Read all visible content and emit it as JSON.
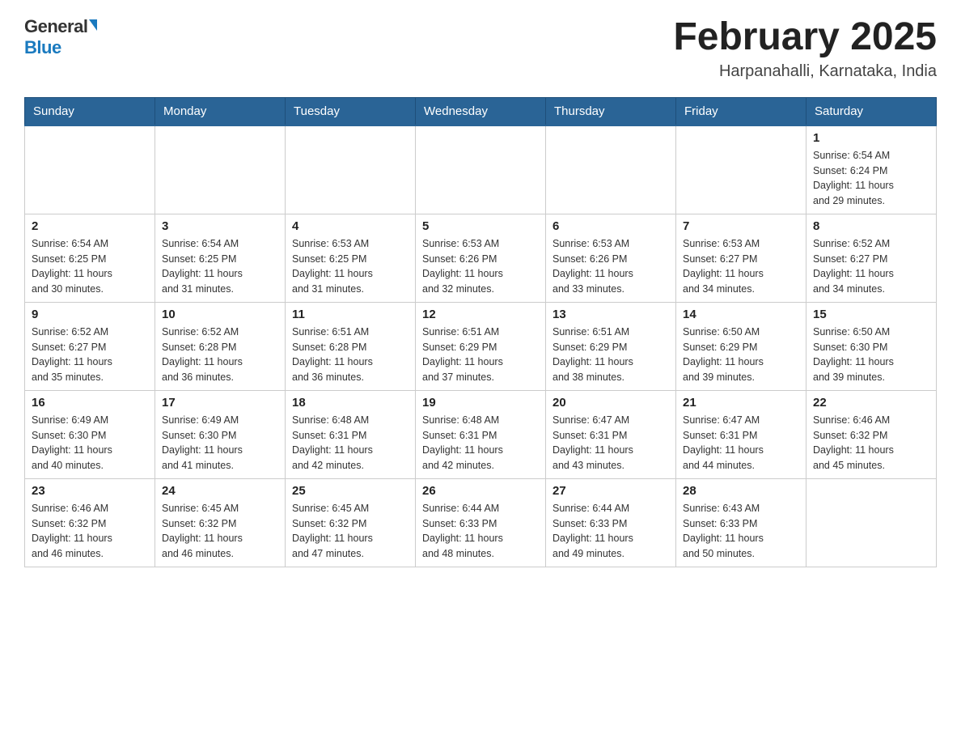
{
  "header": {
    "logo_general": "General",
    "logo_blue": "Blue",
    "month_title": "February 2025",
    "location": "Harpanahalli, Karnataka, India"
  },
  "weekdays": [
    "Sunday",
    "Monday",
    "Tuesday",
    "Wednesday",
    "Thursday",
    "Friday",
    "Saturday"
  ],
  "weeks": [
    [
      {
        "day": "",
        "info": ""
      },
      {
        "day": "",
        "info": ""
      },
      {
        "day": "",
        "info": ""
      },
      {
        "day": "",
        "info": ""
      },
      {
        "day": "",
        "info": ""
      },
      {
        "day": "",
        "info": ""
      },
      {
        "day": "1",
        "info": "Sunrise: 6:54 AM\nSunset: 6:24 PM\nDaylight: 11 hours\nand 29 minutes."
      }
    ],
    [
      {
        "day": "2",
        "info": "Sunrise: 6:54 AM\nSunset: 6:25 PM\nDaylight: 11 hours\nand 30 minutes."
      },
      {
        "day": "3",
        "info": "Sunrise: 6:54 AM\nSunset: 6:25 PM\nDaylight: 11 hours\nand 31 minutes."
      },
      {
        "day": "4",
        "info": "Sunrise: 6:53 AM\nSunset: 6:25 PM\nDaylight: 11 hours\nand 31 minutes."
      },
      {
        "day": "5",
        "info": "Sunrise: 6:53 AM\nSunset: 6:26 PM\nDaylight: 11 hours\nand 32 minutes."
      },
      {
        "day": "6",
        "info": "Sunrise: 6:53 AM\nSunset: 6:26 PM\nDaylight: 11 hours\nand 33 minutes."
      },
      {
        "day": "7",
        "info": "Sunrise: 6:53 AM\nSunset: 6:27 PM\nDaylight: 11 hours\nand 34 minutes."
      },
      {
        "day": "8",
        "info": "Sunrise: 6:52 AM\nSunset: 6:27 PM\nDaylight: 11 hours\nand 34 minutes."
      }
    ],
    [
      {
        "day": "9",
        "info": "Sunrise: 6:52 AM\nSunset: 6:27 PM\nDaylight: 11 hours\nand 35 minutes."
      },
      {
        "day": "10",
        "info": "Sunrise: 6:52 AM\nSunset: 6:28 PM\nDaylight: 11 hours\nand 36 minutes."
      },
      {
        "day": "11",
        "info": "Sunrise: 6:51 AM\nSunset: 6:28 PM\nDaylight: 11 hours\nand 36 minutes."
      },
      {
        "day": "12",
        "info": "Sunrise: 6:51 AM\nSunset: 6:29 PM\nDaylight: 11 hours\nand 37 minutes."
      },
      {
        "day": "13",
        "info": "Sunrise: 6:51 AM\nSunset: 6:29 PM\nDaylight: 11 hours\nand 38 minutes."
      },
      {
        "day": "14",
        "info": "Sunrise: 6:50 AM\nSunset: 6:29 PM\nDaylight: 11 hours\nand 39 minutes."
      },
      {
        "day": "15",
        "info": "Sunrise: 6:50 AM\nSunset: 6:30 PM\nDaylight: 11 hours\nand 39 minutes."
      }
    ],
    [
      {
        "day": "16",
        "info": "Sunrise: 6:49 AM\nSunset: 6:30 PM\nDaylight: 11 hours\nand 40 minutes."
      },
      {
        "day": "17",
        "info": "Sunrise: 6:49 AM\nSunset: 6:30 PM\nDaylight: 11 hours\nand 41 minutes."
      },
      {
        "day": "18",
        "info": "Sunrise: 6:48 AM\nSunset: 6:31 PM\nDaylight: 11 hours\nand 42 minutes."
      },
      {
        "day": "19",
        "info": "Sunrise: 6:48 AM\nSunset: 6:31 PM\nDaylight: 11 hours\nand 42 minutes."
      },
      {
        "day": "20",
        "info": "Sunrise: 6:47 AM\nSunset: 6:31 PM\nDaylight: 11 hours\nand 43 minutes."
      },
      {
        "day": "21",
        "info": "Sunrise: 6:47 AM\nSunset: 6:31 PM\nDaylight: 11 hours\nand 44 minutes."
      },
      {
        "day": "22",
        "info": "Sunrise: 6:46 AM\nSunset: 6:32 PM\nDaylight: 11 hours\nand 45 minutes."
      }
    ],
    [
      {
        "day": "23",
        "info": "Sunrise: 6:46 AM\nSunset: 6:32 PM\nDaylight: 11 hours\nand 46 minutes."
      },
      {
        "day": "24",
        "info": "Sunrise: 6:45 AM\nSunset: 6:32 PM\nDaylight: 11 hours\nand 46 minutes."
      },
      {
        "day": "25",
        "info": "Sunrise: 6:45 AM\nSunset: 6:32 PM\nDaylight: 11 hours\nand 47 minutes."
      },
      {
        "day": "26",
        "info": "Sunrise: 6:44 AM\nSunset: 6:33 PM\nDaylight: 11 hours\nand 48 minutes."
      },
      {
        "day": "27",
        "info": "Sunrise: 6:44 AM\nSunset: 6:33 PM\nDaylight: 11 hours\nand 49 minutes."
      },
      {
        "day": "28",
        "info": "Sunrise: 6:43 AM\nSunset: 6:33 PM\nDaylight: 11 hours\nand 50 minutes."
      },
      {
        "day": "",
        "info": ""
      }
    ]
  ]
}
